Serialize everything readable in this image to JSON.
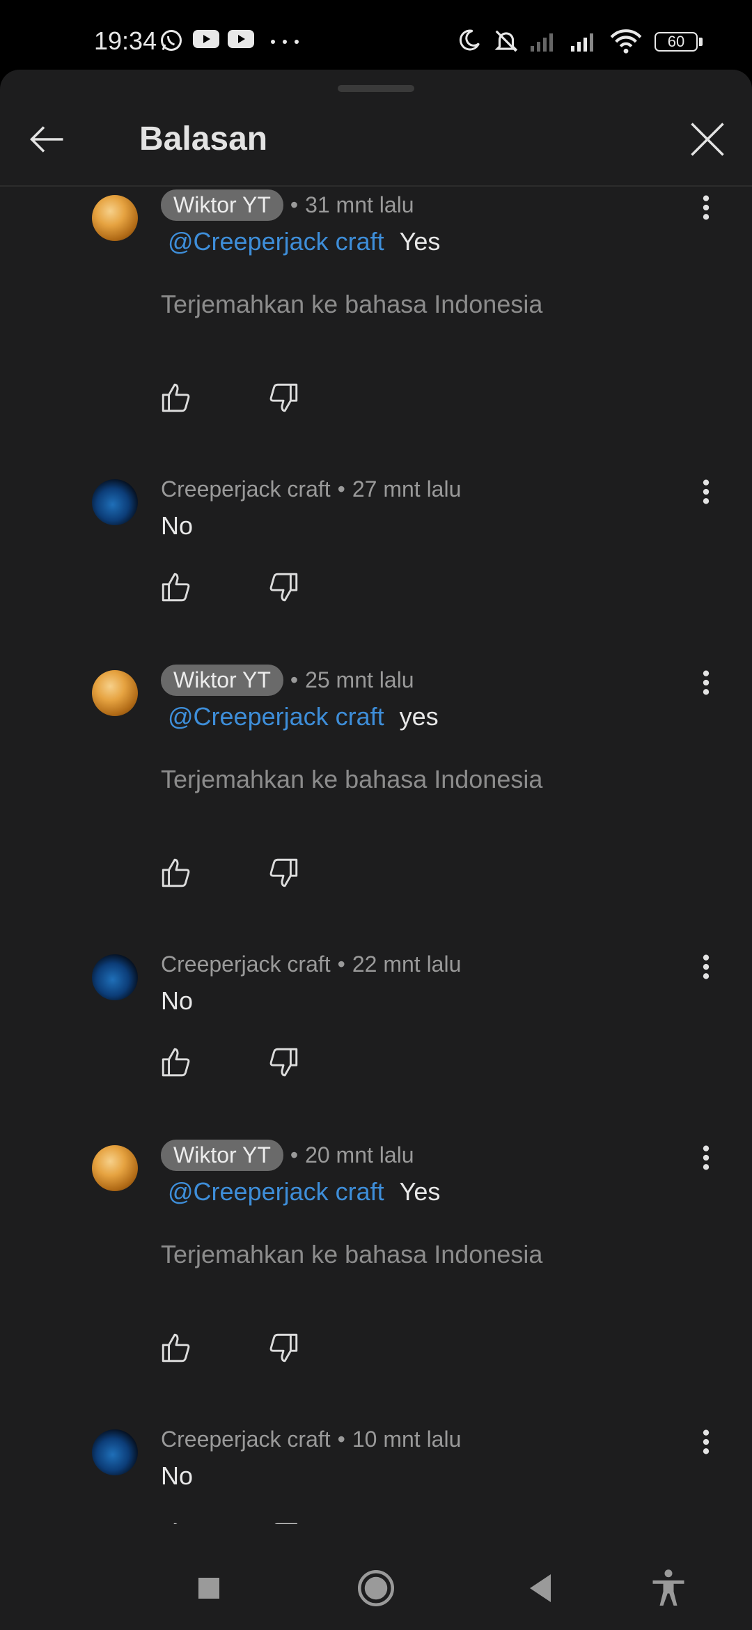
{
  "status_bar": {
    "time": "19:34",
    "battery": "60"
  },
  "header": {
    "title": "Balasan"
  },
  "comments": [
    {
      "author": "Wiktor YT",
      "time": "31 mnt lalu",
      "mention": "@Creeperjack craft",
      "text": "Yes",
      "translate": "Terjemahkan ke bahasa Indonesia"
    },
    {
      "author": "Creeperjack craft",
      "time": "27 mnt lalu",
      "text": "No"
    },
    {
      "author": "Wiktor YT",
      "time": "25 mnt lalu",
      "mention": "@Creeperjack craft",
      "text": "yes",
      "translate": "Terjemahkan ke bahasa Indonesia"
    },
    {
      "author": "Creeperjack craft",
      "time": "22 mnt lalu",
      "text": "No"
    },
    {
      "author": "Wiktor YT",
      "time": "20 mnt lalu",
      "mention": "@Creeperjack craft",
      "text": "Yes",
      "translate": "Terjemahkan ke bahasa Indonesia"
    },
    {
      "author": "Creeperjack craft",
      "time": "10 mnt lalu",
      "text": "No"
    }
  ],
  "separator": "•",
  "icons": {
    "back": "arrow-left-icon",
    "close": "close-icon",
    "more": "more-vertical-icon",
    "like": "thumb-up-icon",
    "dislike": "thumb-down-icon",
    "nav": [
      "recents-square-icon",
      "home-circle-icon",
      "back-triangle-icon",
      "accessibility-icon"
    ]
  },
  "colors": {
    "background": "#1d1d1e",
    "mention": "#3e8ed9",
    "chip": "#6a6a6a",
    "muted": "#9a9a9a"
  }
}
